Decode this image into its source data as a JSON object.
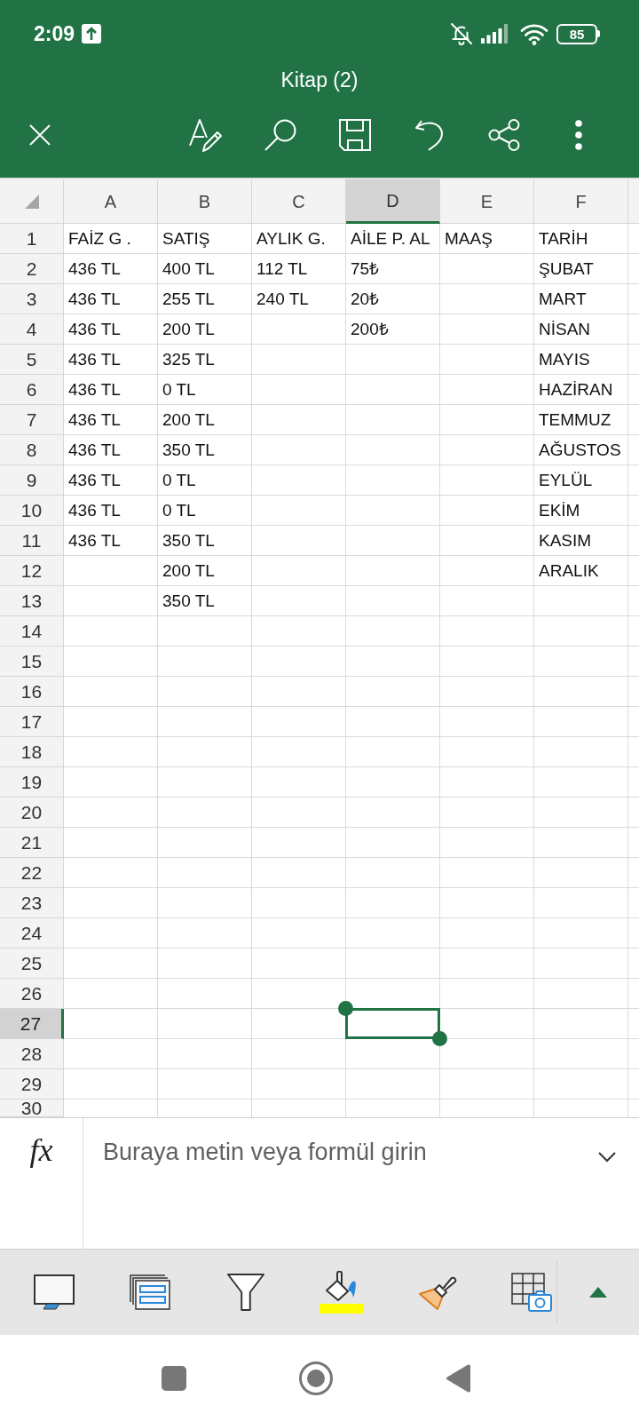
{
  "status_bar": {
    "time": "2:09",
    "battery": "85"
  },
  "title": "Kitap (2)",
  "sheet": {
    "columns": [
      {
        "label": "A",
        "selected": false
      },
      {
        "label": "B",
        "selected": false
      },
      {
        "label": "C",
        "selected": false
      },
      {
        "label": "D",
        "selected": true
      },
      {
        "label": "E",
        "selected": false
      },
      {
        "label": "F",
        "selected": false
      }
    ],
    "rows": [
      {
        "label": "1",
        "selected": false,
        "cells": [
          "FAİZ G .",
          "SATIŞ",
          "AYLIK G.",
          "AİLE P. AL",
          "MAAŞ",
          "TARİH"
        ]
      },
      {
        "label": "2",
        "selected": false,
        "cells": [
          "436 TL",
          "400 TL",
          "112 TL",
          "75₺",
          null,
          "ŞUBAT"
        ]
      },
      {
        "label": "3",
        "selected": false,
        "cells": [
          "436 TL",
          "255 TL",
          "240 TL",
          "20₺",
          null,
          "MART"
        ]
      },
      {
        "label": "4",
        "selected": false,
        "cells": [
          "436 TL",
          "200 TL",
          null,
          "200₺",
          null,
          "NİSAN"
        ]
      },
      {
        "label": "5",
        "selected": false,
        "cells": [
          "436 TL",
          "325 TL",
          null,
          null,
          null,
          "MAYIS"
        ]
      },
      {
        "label": "6",
        "selected": false,
        "cells": [
          "436 TL",
          "0 TL",
          null,
          null,
          null,
          "HAZİRAN"
        ]
      },
      {
        "label": "7",
        "selected": false,
        "cells": [
          "436 TL",
          "200 TL",
          null,
          null,
          null,
          "TEMMUZ"
        ]
      },
      {
        "label": "8",
        "selected": false,
        "cells": [
          "436 TL",
          "350 TL",
          null,
          null,
          null,
          "AĞUSTOS"
        ]
      },
      {
        "label": "9",
        "selected": false,
        "cells": [
          "436 TL",
          "0 TL",
          null,
          null,
          null,
          "EYLÜL"
        ]
      },
      {
        "label": "10",
        "selected": false,
        "cells": [
          "436 TL",
          "0 TL",
          null,
          null,
          null,
          "EKİM"
        ]
      },
      {
        "label": "11",
        "selected": false,
        "cells": [
          "436 TL",
          "350 TL",
          null,
          null,
          null,
          "KASIM"
        ]
      },
      {
        "label": "12",
        "selected": false,
        "cells": [
          null,
          "200 TL",
          null,
          null,
          null,
          "ARALIK"
        ]
      },
      {
        "label": "13",
        "selected": false,
        "cells": [
          null,
          "350 TL"
        ]
      },
      {
        "label": "14",
        "selected": false
      },
      {
        "label": "15",
        "selected": false
      },
      {
        "label": "16",
        "selected": false
      },
      {
        "label": "17",
        "selected": false
      },
      {
        "label": "18",
        "selected": false
      },
      {
        "label": "19",
        "selected": false
      },
      {
        "label": "20",
        "selected": false
      },
      {
        "label": "21",
        "selected": false
      },
      {
        "label": "22",
        "selected": false
      },
      {
        "label": "23",
        "selected": false
      },
      {
        "label": "24",
        "selected": false
      },
      {
        "label": "25",
        "selected": false
      },
      {
        "label": "26",
        "selected": false
      },
      {
        "label": "27",
        "selected": true
      },
      {
        "label": "28",
        "selected": false
      },
      {
        "label": "29",
        "selected": false
      },
      {
        "label": "30",
        "selected": false
      }
    ]
  },
  "formula_bar": {
    "label": "fx",
    "placeholder": "Buraya metin veya formül girin"
  }
}
